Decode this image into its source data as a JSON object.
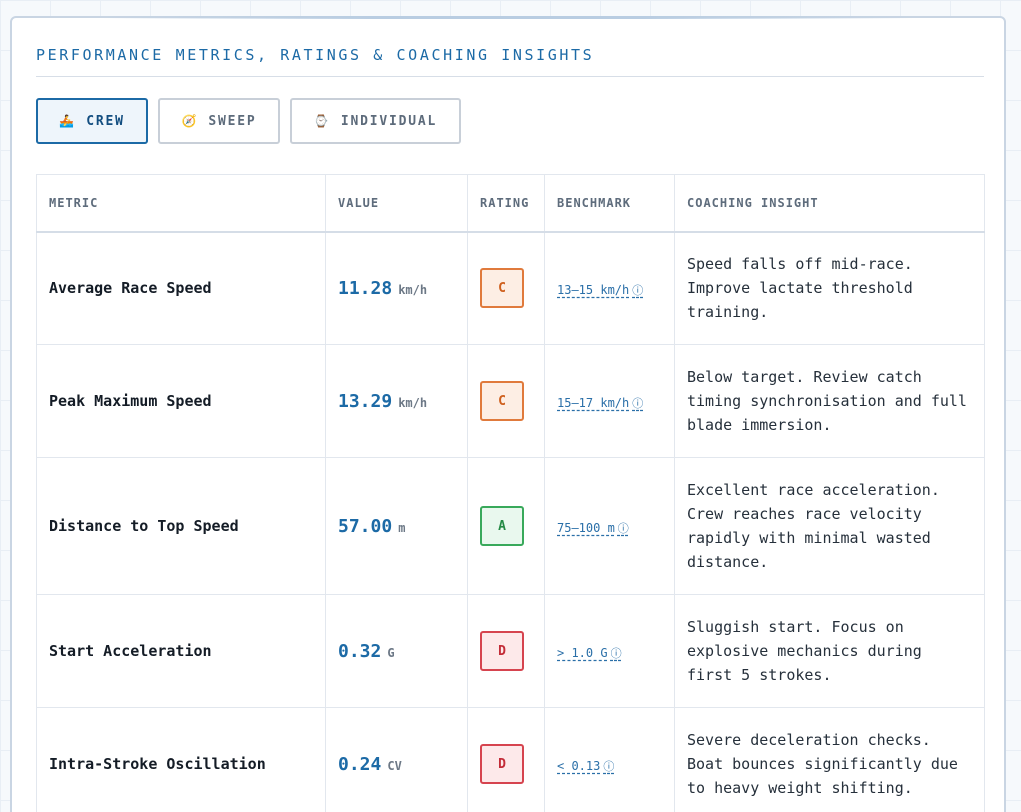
{
  "title": "PERFORMANCE METRICS, RATINGS & COACHING INSIGHTS",
  "tabs": [
    {
      "label": "CREW",
      "icon": "🚣",
      "icon_name": "rowing-boat-icon",
      "active": true
    },
    {
      "label": "SWEEP",
      "icon": "🧭",
      "icon_name": "compass-icon",
      "active": false
    },
    {
      "label": "INDIVIDUAL",
      "icon": "⌚",
      "icon_name": "watch-icon",
      "active": false
    }
  ],
  "table": {
    "headers": [
      "METRIC",
      "VALUE",
      "RATING",
      "BENCHMARK",
      "COACHING INSIGHT"
    ],
    "rows": [
      {
        "metric": "Average Race Speed",
        "value": "11.28",
        "unit": "km/h",
        "rating": "C",
        "benchmark": "13–15 km/h",
        "insight": "Speed falls off mid-race. Improve lactate threshold training."
      },
      {
        "metric": "Peak Maximum Speed",
        "value": "13.29",
        "unit": "km/h",
        "rating": "C",
        "benchmark": "15–17 km/h",
        "insight": "Below target. Review catch timing synchronisation and full blade immersion."
      },
      {
        "metric": "Distance to Top Speed",
        "value": "57.00",
        "unit": "m",
        "rating": "A",
        "benchmark": "75–100 m",
        "insight": "Excellent race acceleration. Crew reaches race velocity rapidly with minimal wasted distance."
      },
      {
        "metric": "Start Acceleration",
        "value": "0.32",
        "unit": "G",
        "rating": "D",
        "benchmark": "> 1.0 G",
        "insight": "Sluggish start. Focus on explosive mechanics during first 5 strokes."
      },
      {
        "metric": "Intra-Stroke Oscillation",
        "value": "0.24",
        "unit": "CV",
        "rating": "D",
        "benchmark": "< 0.13",
        "insight": "Severe deceleration checks. Boat bounces significantly due to heavy weight shifting."
      }
    ]
  },
  "colors": {
    "accent": "#1c6aa6",
    "rating_A": "#39a95b",
    "rating_C": "#e07a3c",
    "rating_D": "#d6444f"
  },
  "info_icon": "ⓘ"
}
